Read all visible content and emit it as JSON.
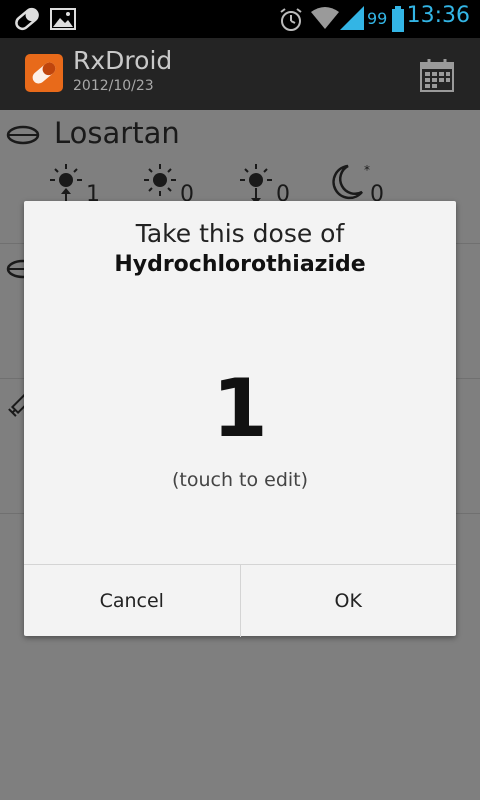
{
  "status_bar": {
    "time": "13:36",
    "battery_level": "99",
    "accent_color": "#33b5e5",
    "icons": [
      "pill-notification-icon",
      "image-notification-icon",
      "alarm-icon",
      "wifi-icon",
      "signal-icon",
      "battery-icon"
    ]
  },
  "action_bar": {
    "title": "RxDroid",
    "date": "2012/10/23",
    "icon": "rxdroid-app-icon",
    "action_icon": "calendar-icon"
  },
  "list": {
    "drugs": [
      {
        "name": "Losartan",
        "icon": "pill-icon",
        "doses": [
          {
            "icon": "sunrise-icon",
            "value": "1"
          },
          {
            "icon": "sun-icon",
            "value": "0"
          },
          {
            "icon": "sunset-icon",
            "value": "0"
          },
          {
            "icon": "moon-icon",
            "value": "0"
          }
        ]
      },
      {
        "name": "",
        "icon": "pill-icon"
      },
      {
        "name": "",
        "icon": "syringe-icon"
      }
    ]
  },
  "dialog": {
    "title_line1": "Take this dose of",
    "title_line2": "Hydrochlorothiazide",
    "dose_value": "1",
    "hint": "(touch to edit)",
    "cancel_label": "Cancel",
    "ok_label": "OK"
  },
  "colors": {
    "app_icon": "#e86a1a",
    "dialog_bg": "#f3f3f3",
    "dim_overlay": "#7f7f7f"
  }
}
